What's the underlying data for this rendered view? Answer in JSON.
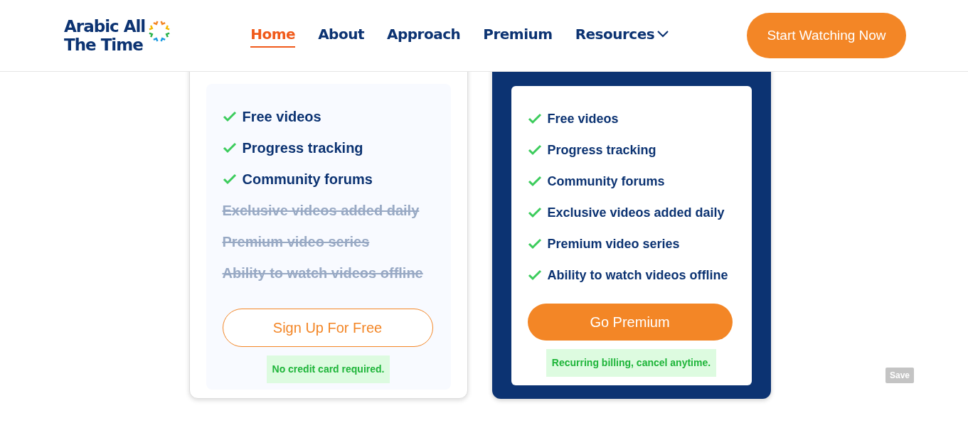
{
  "header": {
    "logo_lines": [
      "Arabic All",
      "The Time"
    ],
    "nav": [
      {
        "label": "Home",
        "selected": true,
        "dropdown": false
      },
      {
        "label": "About",
        "selected": false,
        "dropdown": false
      },
      {
        "label": "Approach",
        "selected": false,
        "dropdown": false
      },
      {
        "label": "Premium",
        "selected": false,
        "dropdown": false
      },
      {
        "label": "Resources",
        "selected": false,
        "dropdown": true
      }
    ],
    "cta": "Start Watching Now"
  },
  "plans": [
    {
      "kind": "free",
      "features": [
        {
          "label": "Free videos",
          "included": true
        },
        {
          "label": "Progress tracking",
          "included": true
        },
        {
          "label": "Community forums",
          "included": true
        },
        {
          "label": "Exclusive videos added daily",
          "included": false
        },
        {
          "label": "Premium video series",
          "included": false
        },
        {
          "label": "Ability to watch videos offline",
          "included": false
        }
      ],
      "button": "Sign Up For Free",
      "note": "No credit card required."
    },
    {
      "kind": "premium",
      "features": [
        {
          "label": "Free videos",
          "included": true
        },
        {
          "label": "Progress tracking",
          "included": true
        },
        {
          "label": "Community forums",
          "included": true
        },
        {
          "label": "Exclusive videos added daily",
          "included": true
        },
        {
          "label": "Premium video series",
          "included": true
        },
        {
          "label": "Ability to watch videos offline",
          "included": true
        }
      ],
      "button": "Go Premium",
      "note": "Recurring billing, cancel anytime."
    }
  ],
  "save_button": "Save"
}
